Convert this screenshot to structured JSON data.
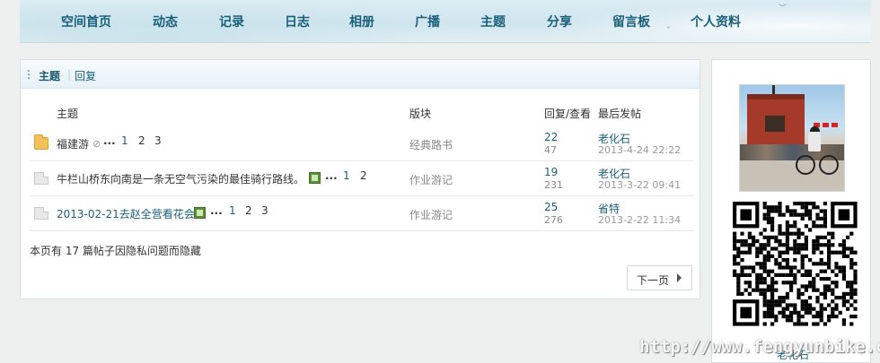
{
  "nav": {
    "items": [
      {
        "label": "空间首页"
      },
      {
        "label": "动态"
      },
      {
        "label": "记录"
      },
      {
        "label": "日志"
      },
      {
        "label": "相册"
      },
      {
        "label": "广播"
      },
      {
        "label": "主题"
      },
      {
        "label": "分享"
      },
      {
        "label": "留言板"
      },
      {
        "label": "个人资料"
      }
    ]
  },
  "tabs": {
    "active": "主题",
    "other": "回复"
  },
  "columns": {
    "topic": "主题",
    "forum": "版块",
    "stats": "回复/查看",
    "last_post": "最后发帖"
  },
  "threads": [
    {
      "title": "福建游",
      "has_attachment": true,
      "has_image": false,
      "ellipsis": "...",
      "pages": [
        "1",
        "2",
        "3"
      ],
      "forum": "经典路书",
      "replies": "22",
      "views": "47",
      "last_poster": "老化石",
      "last_time": "2013-4-24 22:22"
    },
    {
      "title": "牛栏山桥东向南是一条无空气污染的最佳骑行路线。",
      "has_attachment": false,
      "has_image": true,
      "ellipsis": "...",
      "pages": [
        "1",
        "2"
      ],
      "forum": "作业游记",
      "replies": "19",
      "views": "231",
      "last_poster": "老化石",
      "last_time": "2013-3-22 09:41"
    },
    {
      "title": "2013-02-21去赵全营看花会",
      "has_attachment": false,
      "has_image": true,
      "ellipsis": "...",
      "pages": [
        "1",
        "2",
        "3"
      ],
      "forum": "作业游记",
      "replies": "25",
      "views": "276",
      "last_poster": "省特",
      "last_time": "2013-2-22 11:34"
    }
  ],
  "hidden_note": "本页有 17 篇帖子因隐私问题而隐藏",
  "pager": {
    "next_label": "下一页"
  },
  "sidebar": {
    "photo_icon": "avatar-photo",
    "qr_icon": "qr-code",
    "partial_label": "老化石"
  },
  "watermark": "http://www.fengyunbike.com",
  "colors": {
    "link": "#1a5f7a",
    "muted": "#888888",
    "folder_new": "#f2c15a"
  }
}
